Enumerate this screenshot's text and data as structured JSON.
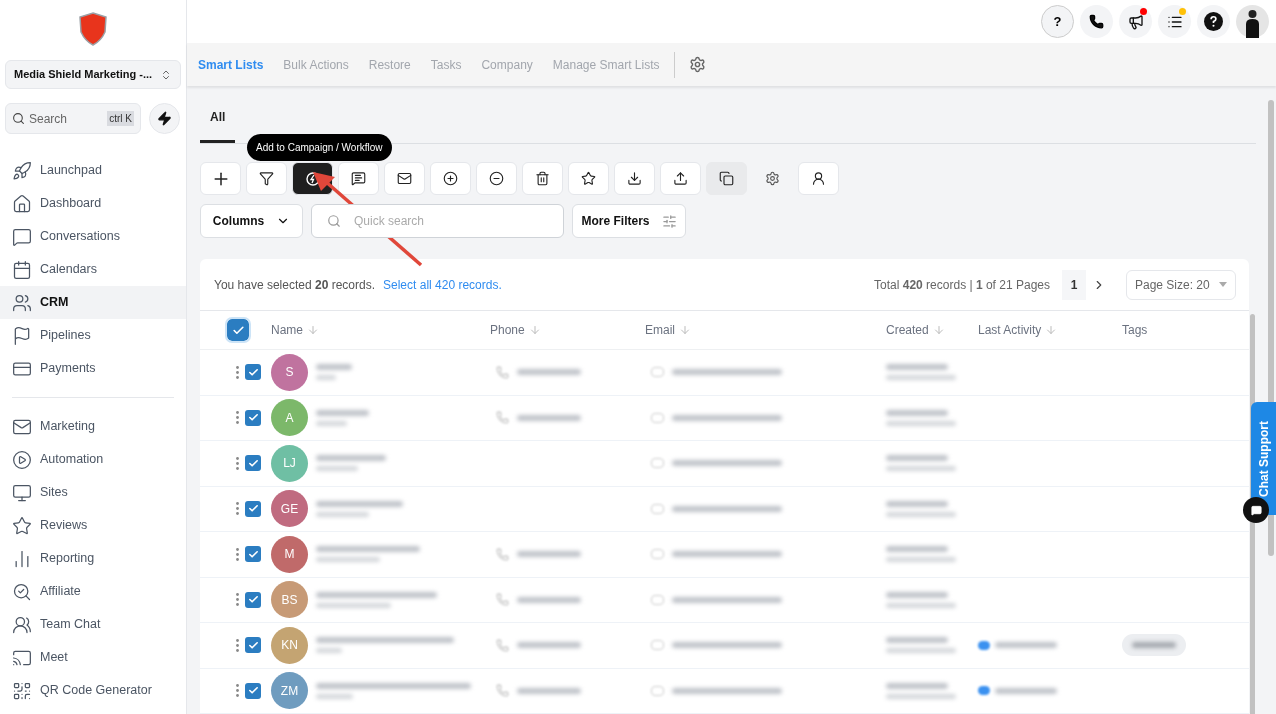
{
  "sidebar": {
    "account": "Media Shield Marketing -...",
    "search": {
      "placeholder": "Search",
      "shortcut": "ctrl K"
    },
    "items": [
      {
        "label": "Launchpad",
        "selected": false
      },
      {
        "label": "Dashboard",
        "selected": false
      },
      {
        "label": "Conversations",
        "selected": false
      },
      {
        "label": "Calendars",
        "selected": false
      },
      {
        "label": "CRM",
        "selected": true
      },
      {
        "label": "Pipelines",
        "selected": false
      },
      {
        "label": "Payments",
        "selected": false
      }
    ],
    "items_2": [
      {
        "label": "Marketing",
        "selected": false
      },
      {
        "label": "Automation",
        "selected": false
      },
      {
        "label": "Sites",
        "selected": false
      },
      {
        "label": "Reviews",
        "selected": false
      },
      {
        "label": "Reporting",
        "selected": false
      },
      {
        "label": "Affiliate",
        "selected": false
      },
      {
        "label": "Team Chat",
        "selected": false
      },
      {
        "label": "Meet",
        "selected": false
      },
      {
        "label": "QR Code Generator",
        "selected": false
      }
    ]
  },
  "header": {
    "help": "?",
    "notifications": [
      {
        "color": "#ff0000"
      },
      {
        "color": "#ffc107"
      }
    ]
  },
  "nav_tabs": [
    {
      "label": "Smart Lists",
      "selected": true
    },
    {
      "label": "Bulk Actions",
      "selected": false
    },
    {
      "label": "Restore",
      "selected": false
    },
    {
      "label": "Tasks",
      "selected": false
    },
    {
      "label": "Company",
      "selected": false
    },
    {
      "label": "Manage Smart Lists",
      "selected": false
    }
  ],
  "list_tabs": [
    {
      "label": "All",
      "selected": true
    }
  ],
  "tooltip": "Add to Campaign / Workflow",
  "toolbar": [
    {
      "kind": "boxed",
      "active": false
    },
    {
      "kind": "boxed",
      "active": false
    },
    {
      "kind": "boxed",
      "active": true
    },
    {
      "kind": "boxed",
      "active": false
    },
    {
      "kind": "boxed",
      "active": false
    },
    {
      "kind": "boxed",
      "active": false
    },
    {
      "kind": "boxed",
      "active": false
    },
    {
      "kind": "boxed",
      "active": false
    },
    {
      "kind": "boxed",
      "active": false
    },
    {
      "kind": "boxed",
      "active": false
    },
    {
      "kind": "boxed",
      "active": false
    },
    {
      "kind": "shaded",
      "active": false
    },
    {
      "kind": "bare",
      "active": false
    },
    {
      "kind": "boxed",
      "active": false
    }
  ],
  "filters": {
    "columns": "Columns",
    "search_placeholder": "Quick search",
    "more_filters": "More Filters"
  },
  "selection": {
    "text": "You have selected **20** records.",
    "link": "Select all 420 records."
  },
  "pagination": {
    "summary": "Total **420** records | **1** of 21 Pages",
    "page": "1",
    "page_size": "Page Size: 20"
  },
  "table": {
    "all_checked": true,
    "columns": [
      "Name",
      "Phone",
      "Email",
      "Created",
      "Last Activity",
      "Tags"
    ],
    "rows": [
      {
        "initials": "S",
        "color": "#c0739f",
        "checked": true,
        "has_phone": true,
        "has_activity": false,
        "has_tag": false
      },
      {
        "initials": "A",
        "color": "#7cb86a",
        "checked": true,
        "has_phone": true,
        "has_activity": false,
        "has_tag": false
      },
      {
        "initials": "LJ",
        "color": "#6fbfa4",
        "checked": true,
        "has_phone": false,
        "has_activity": false,
        "has_tag": false
      },
      {
        "initials": "GE",
        "color": "#c06b80",
        "checked": true,
        "has_phone": false,
        "has_activity": false,
        "has_tag": false
      },
      {
        "initials": "M",
        "color": "#c06a6a",
        "checked": true,
        "has_phone": true,
        "has_activity": false,
        "has_tag": false
      },
      {
        "initials": "BS",
        "color": "#c79a76",
        "checked": true,
        "has_phone": true,
        "has_activity": false,
        "has_tag": false
      },
      {
        "initials": "KN",
        "color": "#c4a472",
        "checked": true,
        "has_phone": true,
        "has_activity": true,
        "has_tag": true
      },
      {
        "initials": "ZM",
        "color": "#6f9cbf",
        "checked": true,
        "has_phone": true,
        "has_activity": true,
        "has_tag": false
      }
    ]
  },
  "chat_support": "Chat Support"
}
